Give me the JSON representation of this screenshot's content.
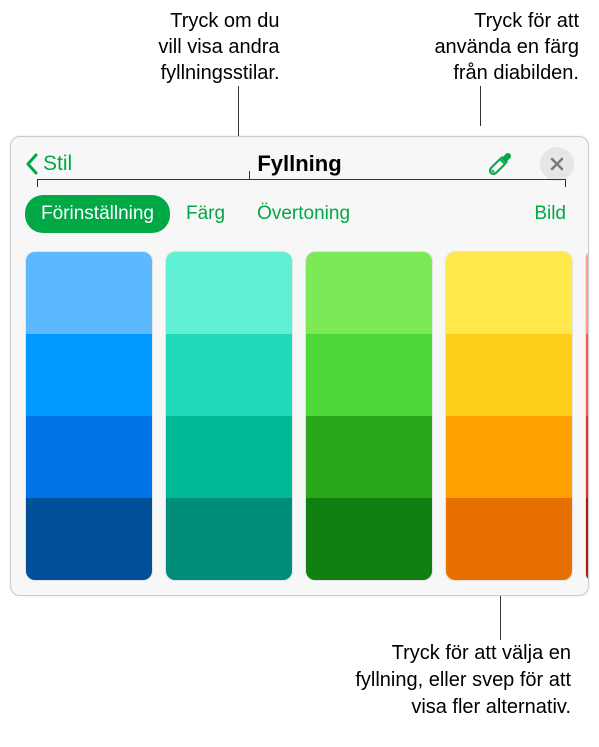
{
  "callouts": {
    "topLeft": "Tryck om du\nvill visa andra\nfyllningsstilar.",
    "topRight": "Tryck för att\nanvända en färg\nfrån diabilden.",
    "bottom": "Tryck för att välja en\nfyllning, eller svep för att\nvisa fler alternativ."
  },
  "header": {
    "backLabel": "Stil",
    "title": "Fyllning"
  },
  "tabs": {
    "preset": "Förinställning",
    "color": "Färg",
    "gradient": "Övertoning",
    "image": "Bild"
  },
  "swatches": [
    [
      "#5cb9ff",
      "#0099ff",
      "#0073e6",
      "#005099"
    ],
    [
      "#5ff0d6",
      "#1fd9b8",
      "#00b894",
      "#008e7a"
    ],
    [
      "#7bea56",
      "#4cd837",
      "#2aa819",
      "#108010"
    ],
    [
      "#ffe94a",
      "#ffce1a",
      "#ff9f00",
      "#e87000"
    ],
    [
      "#ff9a8e",
      "#ff5a4d",
      "#e33228",
      "#b01810"
    ]
  ]
}
